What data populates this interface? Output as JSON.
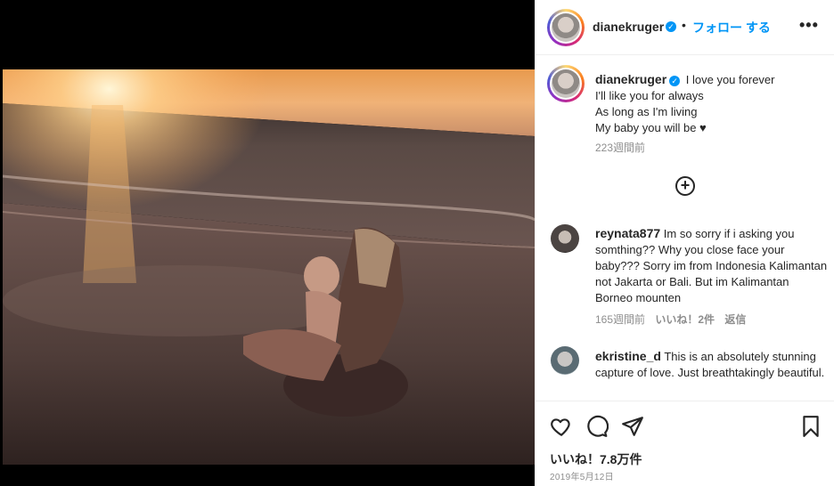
{
  "post": {
    "username": "dianekruger",
    "follow_label": "フォロー する",
    "separator": "•",
    "more_label": "•••",
    "verified_mark": "✓"
  },
  "caption": {
    "username": "dianekruger",
    "lines": [
      "I love you forever",
      "I'll like you for always",
      "As long as I'm living",
      "My baby you will be ♥"
    ],
    "time": "223週間前"
  },
  "load_more_label": "+",
  "comments": [
    {
      "username": "reynata877",
      "text": "Im so sorry if i asking you somthing?? Why you close face your baby??? Sorry im from Indonesia Kalimantan not Jakarta or Bali. But im Kalimantan Borneo mounten",
      "time": "165週間前",
      "likes": "いいね！2件",
      "reply": "返信"
    },
    {
      "username": "ekristine_d",
      "text": "This is an absolutely stunning capture of love. Just breathtakingly beautiful."
    }
  ],
  "actions": {
    "icons": [
      "heart-icon",
      "comment-icon",
      "share-icon",
      "bookmark-icon"
    ]
  },
  "likes_label": "いいね！7.8万件",
  "date_label": "2019年5月12日",
  "colors": {
    "accent": "#0095f6",
    "text": "#262626",
    "muted": "#8e8e8e"
  }
}
